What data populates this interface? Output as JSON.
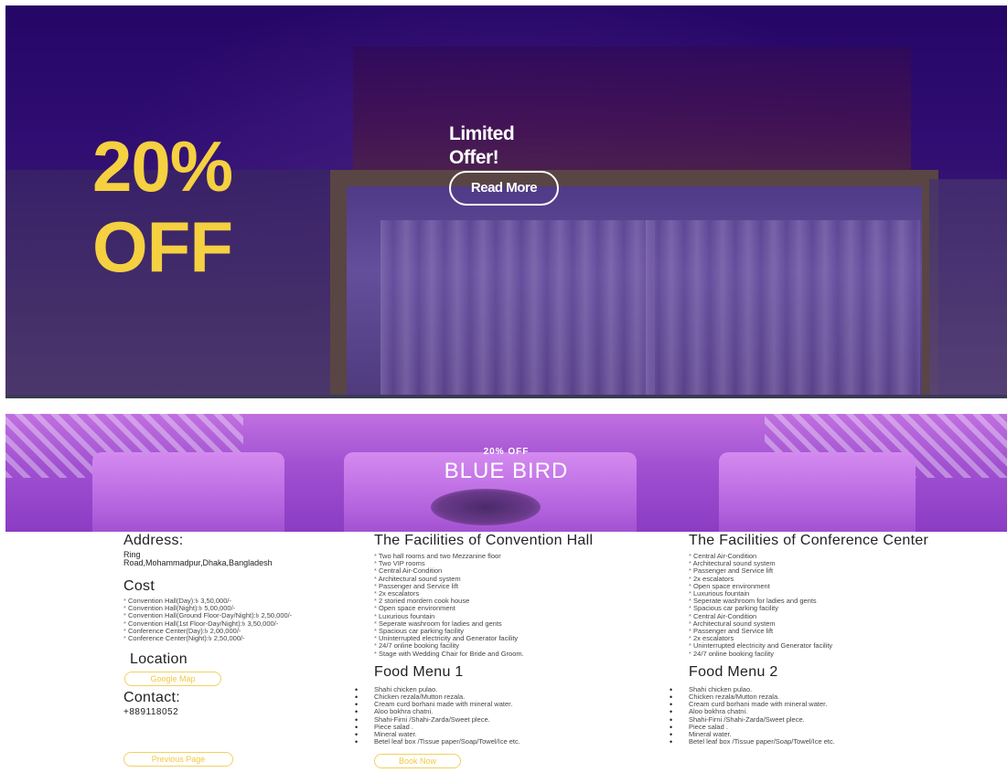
{
  "hero": {
    "discount_line1": "20%",
    "discount_line2": "OFF",
    "offer_line1": "Limited",
    "offer_line2": "Offer!",
    "read_more": "Read More",
    "discount_color": "#f5d040"
  },
  "banner": {
    "small_text": "20% OFF",
    "title": "BLUE BIRD"
  },
  "left": {
    "address_heading": "Address:",
    "address_line1": "Ring",
    "address_line2": "Road,Mohammadpur,Dhaka,Bangladesh",
    "cost_heading": "Cost",
    "costs": [
      "Convention Hall(Day):৳ 3,50,000/-",
      "Convention Hall(Night):৳ 5,00,000/-",
      "Convention Hall(Ground Floor-Day/Night):৳ 2,50,000/-",
      "Convention Hall(1st Floor-Day/Night):৳ 3,50,000/-",
      "Conference Center(Day):৳ 2,00,000/-",
      "Conference Center(Night):৳ 2,50,000/-"
    ],
    "location_heading": "Location",
    "map_button": "Google Map",
    "contact_heading": "Contact:",
    "phone": "+889118052",
    "previous_button": "Previous Page"
  },
  "convention": {
    "heading": "The Facilities of Convention Hall",
    "items": [
      "Two hall rooms and two Mezzanine floor",
      "Two VIP rooms",
      "Central Air-Condition",
      "Architectural sound system",
      "Passenger and Service lift",
      "2x escalators",
      "2 storied mordern cook house",
      "Open space environment",
      "Luxurious fountain",
      "Seperate washroom for ladies and gents",
      "Spacious car parking facility",
      "Uninterrupted electricity and Generator facility",
      "24/7 online booking facility",
      "Stage with Wedding Chair for Bride and Groom."
    ],
    "food_heading": "Food Menu 1",
    "food": [
      "Shahi chicken pulao.",
      "Chicken rezala/Mutton rezala.",
      "Cream curd borhani made with mineral water.",
      "Aloo bokhra chatni.",
      "Shahi-Firni /Shahi-Zarda/Sweet plece.",
      "Piece salad .",
      "Mineral water.",
      "Betel leaf box /Tissue paper/Soap/Towel/Ice etc."
    ],
    "book_button": "Book Now"
  },
  "conference": {
    "heading": "The Facilities of Conference Center",
    "items": [
      "Central Air-Condition",
      "Architectural sound system",
      "Passenger and Service lift",
      "2x escalators",
      "Open space environment",
      "Luxurious fountain",
      "Seperate washroom for ladies and gents",
      "Spacious car parking facility",
      "Central Air-Condition",
      "Architectural sound system",
      "Passenger and Service lift",
      "2x escalators",
      "Uninterrupted electricity and Generator facility",
      "24/7 online booking facility"
    ],
    "food_heading": "Food Menu 2",
    "food": [
      "Shahi chicken pulao.",
      "Chicken rezala/Mutton rezala.",
      "Cream curd borhani made with mineral water.",
      "Aloo bokhra chatni.",
      "Shahi-Firni /Shahi-Zarda/Sweet plece.",
      "Piece salad .",
      "Mineral water.",
      "Betel leaf box /Tissue paper/Soap/Towel/Ice etc."
    ]
  }
}
